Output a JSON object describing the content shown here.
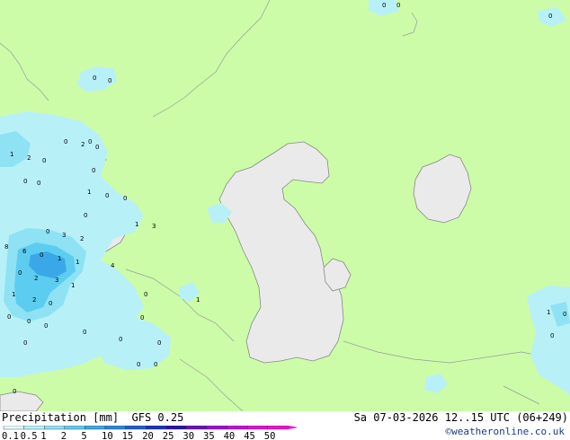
{
  "footer": {
    "title": "Precipitation [mm]",
    "model": "GFS 0.25",
    "run": "Sa 07-03-2026 12..15 UTC (06+249)",
    "credit": "©weatheronline.co.uk"
  },
  "legend": {
    "values": [
      "0.1",
      "0.5",
      "1",
      "2",
      "5",
      "10",
      "15",
      "20",
      "25",
      "30",
      "35",
      "40",
      "45",
      "50"
    ],
    "colors": [
      "#e8fafc",
      "#b8f0f8",
      "#8ee2f4",
      "#5ccdf0",
      "#3aa8e8",
      "#2a86e0",
      "#1e5cd4",
      "#1a32c0",
      "#2a12a8",
      "#6a0ec0",
      "#9a0ed0",
      "#c40ed8",
      "#e20ed8",
      "#f20ed0"
    ]
  },
  "map": {
    "land_color": "#ccfca8",
    "sea_color": "#eaeaea",
    "labels": [
      "0",
      "0",
      "0",
      "0",
      "0",
      "0",
      "0",
      "2",
      "0",
      "1",
      "2",
      "0",
      "0",
      "0",
      "0",
      "1",
      "0",
      "0",
      "0",
      "1",
      "3",
      "0",
      "3",
      "2",
      "8",
      "6",
      "0",
      "1",
      "1",
      "4",
      "0",
      "2",
      "3",
      "1",
      "1",
      "2",
      "0",
      "0",
      "1",
      "0",
      "0",
      "0",
      "0",
      "0",
      "0",
      "0",
      "0",
      "0",
      "0",
      "0",
      "1",
      "0",
      "0"
    ]
  }
}
